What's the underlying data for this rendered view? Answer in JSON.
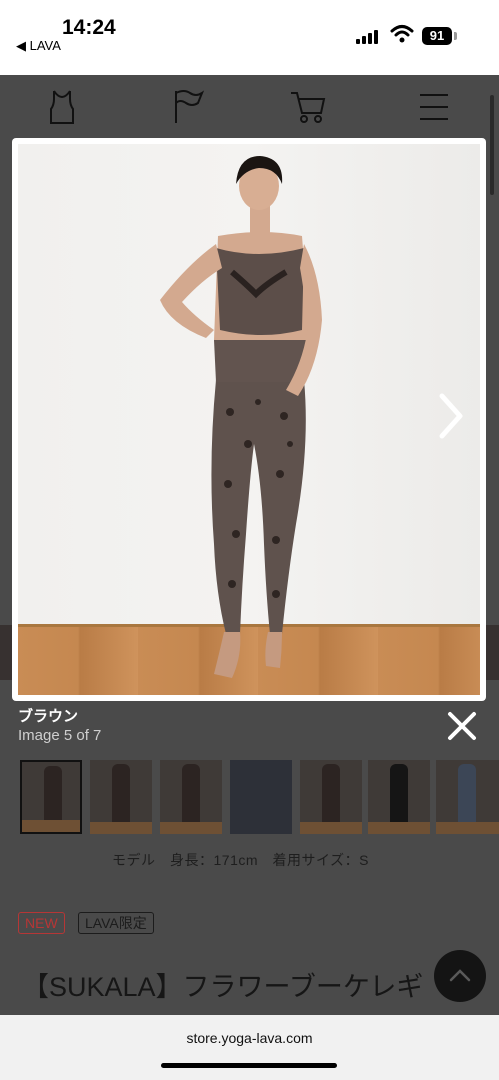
{
  "status_bar": {
    "time": "14:24",
    "back_label": "◀ LAVA",
    "battery": "91"
  },
  "gallery": {
    "caption_title": "ブラウン",
    "caption_count": "Image 5 of 7"
  },
  "product": {
    "model_info": "モデル　身長：171cm　着用サイズ：S",
    "badges": [
      "NEW",
      "LAVA限定"
    ],
    "title": "【SUKALA】フラワーブーケレギ"
  },
  "browser": {
    "url": "store.yoga-lava.com"
  },
  "colors": {
    "accent_red": "#b63636",
    "overlay": "#4a4a4a"
  }
}
